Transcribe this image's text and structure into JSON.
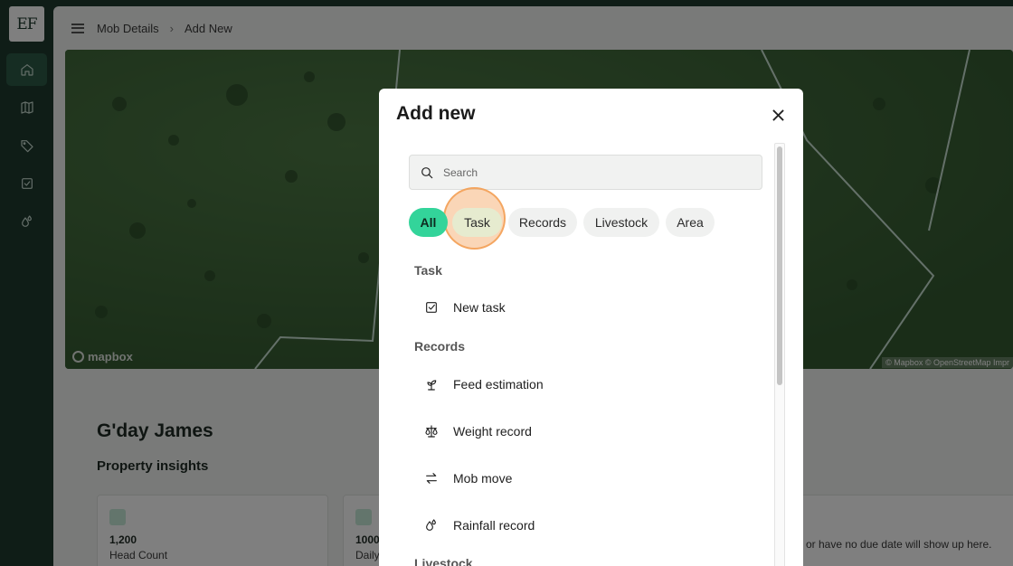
{
  "sidebar": {
    "logo": "EF",
    "items": [
      {
        "name": "home",
        "icon": "home-icon",
        "active": true
      },
      {
        "name": "map",
        "icon": "map-icon",
        "active": false
      },
      {
        "name": "tags",
        "icon": "tag-icon",
        "active": false
      },
      {
        "name": "tasks",
        "icon": "checkbox-icon",
        "active": false
      },
      {
        "name": "rainfall",
        "icon": "rain-drops-icon",
        "active": false
      }
    ]
  },
  "breadcrumb": {
    "parent": "Mob Details",
    "current": "Add New"
  },
  "map": {
    "logo_text": "mapbox",
    "attribution": "© Mapbox © OpenStreetMap  Impr"
  },
  "dashboard": {
    "greeting": "G'day James",
    "insights_title": "Property insights",
    "cards": [
      {
        "value": "1,200",
        "label": "Head Count"
      },
      {
        "value": "1000",
        "label": "Daily"
      }
    ],
    "right_card_text": "or have no due date will show up here."
  },
  "modal": {
    "title": "Add new",
    "search": {
      "placeholder": "Search",
      "value": ""
    },
    "filters": [
      {
        "label": "All",
        "active": true
      },
      {
        "label": "Task",
        "active": false,
        "hover": true
      },
      {
        "label": "Records",
        "active": false
      },
      {
        "label": "Livestock",
        "active": false
      },
      {
        "label": "Area",
        "active": false
      }
    ],
    "sections": [
      {
        "title": "Task",
        "items": [
          {
            "label": "New task",
            "icon": "checkbox-icon"
          }
        ]
      },
      {
        "title": "Records",
        "items": [
          {
            "label": "Feed estimation",
            "icon": "sprout-icon"
          },
          {
            "label": "Weight record",
            "icon": "scale-icon"
          },
          {
            "label": "Mob move",
            "icon": "arrows-swap-icon"
          },
          {
            "label": "Rainfall record",
            "icon": "rain-drops-icon"
          }
        ]
      },
      {
        "title": "Livestock",
        "items": []
      }
    ]
  },
  "colors": {
    "sidebar_bg": "#1e3a2f",
    "accent": "#33d49a",
    "highlight_ring": "#f39e52"
  }
}
